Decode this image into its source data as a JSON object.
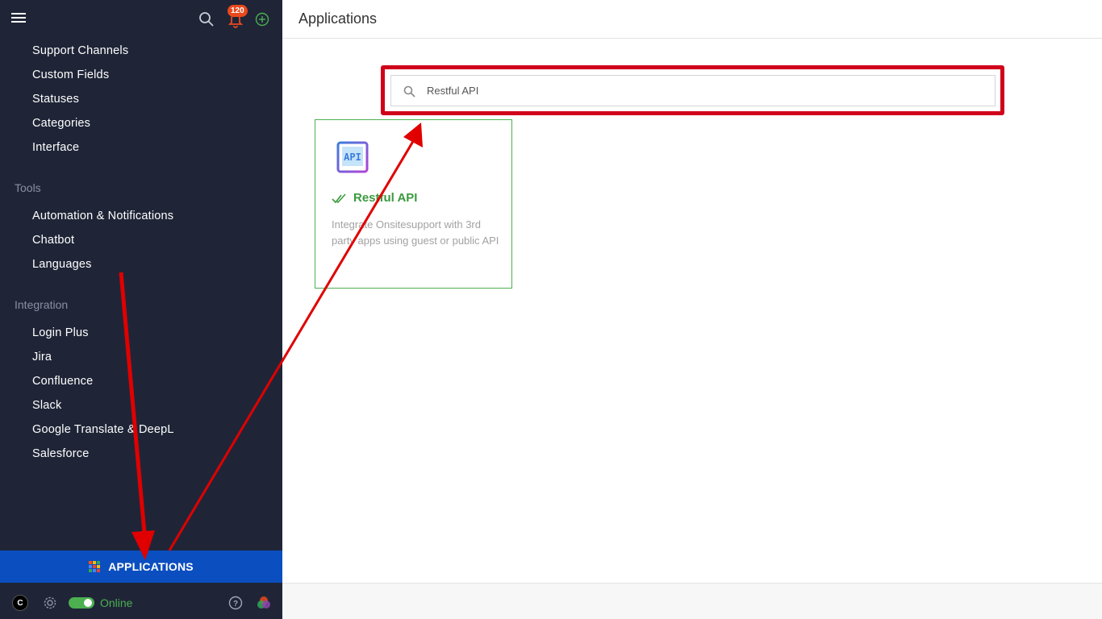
{
  "header": {
    "title": "Applications"
  },
  "topbar": {
    "notification_count": "120"
  },
  "sidebar": {
    "items_top": [
      {
        "label": "Support Channels"
      },
      {
        "label": "Custom Fields"
      },
      {
        "label": "Statuses"
      },
      {
        "label": "Categories"
      },
      {
        "label": "Interface"
      }
    ],
    "tools": {
      "section_label": "Tools",
      "items": [
        {
          "label": "Automation & Notifications"
        },
        {
          "label": "Chatbot"
        },
        {
          "label": "Languages"
        }
      ]
    },
    "integration": {
      "section_label": "Integration",
      "items": [
        {
          "label": "Login Plus"
        },
        {
          "label": "Jira"
        },
        {
          "label": "Confluence"
        },
        {
          "label": "Slack"
        },
        {
          "label": "Google Translate & DeepL"
        },
        {
          "label": "Salesforce"
        }
      ]
    },
    "applications_label": "APPLICATIONS",
    "user_initial": "C",
    "status_label": "Online"
  },
  "search": {
    "value": "Restful API",
    "placeholder": ""
  },
  "app_card": {
    "title": "Restful API",
    "description": "Integrate Onsitesupport with 3rd party apps using guest or public API",
    "icon": "api-icon",
    "installed": true
  },
  "colors": {
    "sidebar_bg": "#1f2537",
    "applications_bar": "#0b4ebf",
    "accent_green": "#3a9a3f",
    "highlight_red": "#d0021b",
    "badge": "#e8491d"
  },
  "icons": [
    "menu-icon",
    "search-icon",
    "bell-icon",
    "plus-circle-icon",
    "apps-grid-icon",
    "gear-icon",
    "help-icon",
    "brand-icon",
    "check-icon",
    "api-icon"
  ]
}
